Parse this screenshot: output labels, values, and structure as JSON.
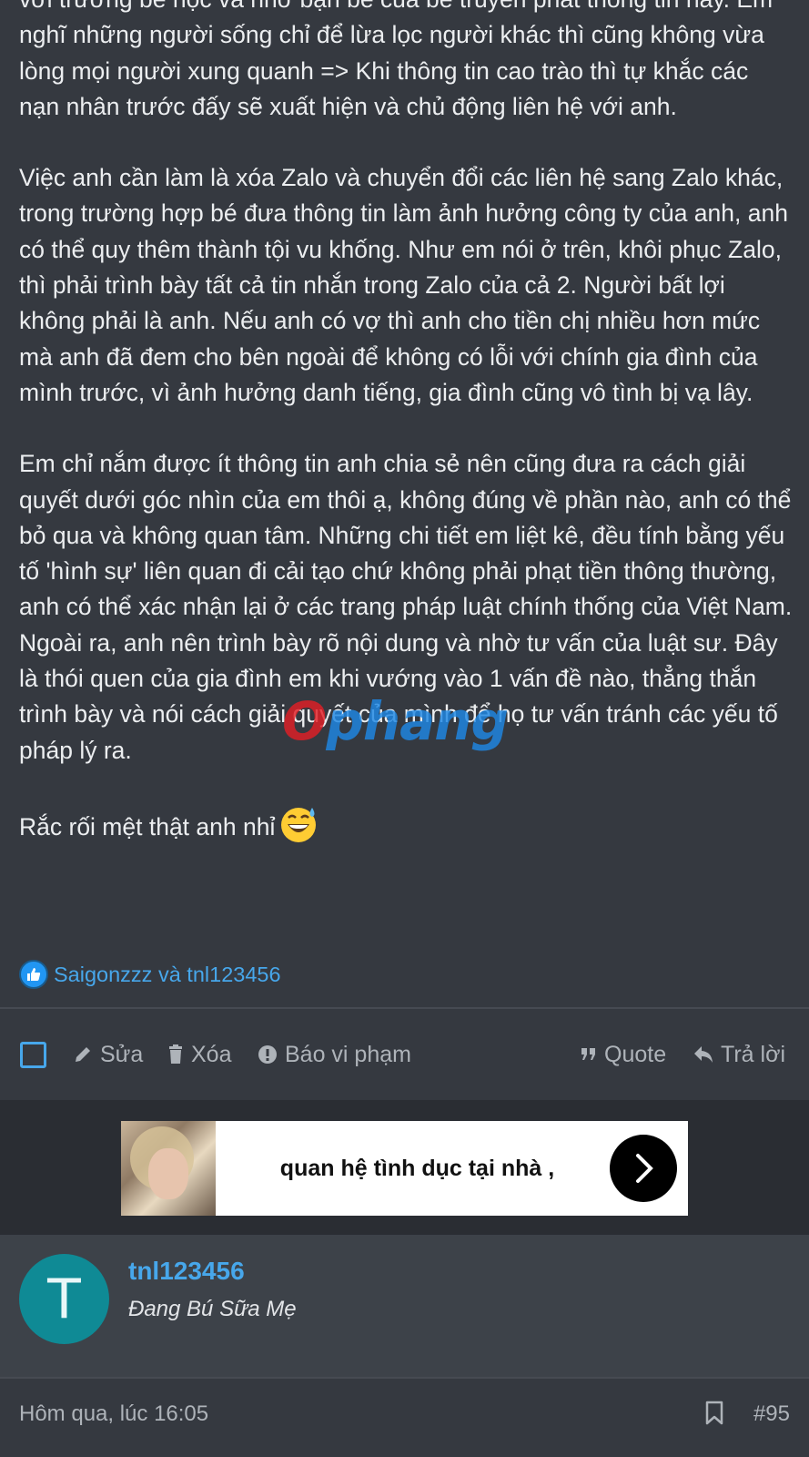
{
  "post": {
    "paragraphs": [
      "với trường bé học và nhờ bạn bè của bé truyền phát thông tin này. Em nghĩ những người sống chỉ để lừa lọc người khác thì cũng không vừa lòng mọi người xung quanh => Khi thông tin cao trào thì tự khắc các nạn nhân trước đấy sẽ xuất hiện và chủ động liên hệ với anh.",
      "Việc anh cần làm là xóa Zalo và chuyển đổi các liên hệ sang Zalo khác, trong trường hợp bé đưa thông tin làm ảnh hưởng công ty của anh, anh có thể quy thêm thành tội vu khống. Như em nói ở trên, khôi phục Zalo, thì phải trình bày tất cả tin nhắn trong Zalo của cả 2. Người bất lợi không phải là anh. Nếu anh có vợ thì anh cho tiền chị nhiều hơn mức mà anh đã đem cho bên ngoài để không có lỗi với chính gia đình của mình trước, vì ảnh hưởng danh tiếng, gia đình cũng vô tình bị vạ lây.",
      "Em chỉ nắm được ít thông tin anh chia sẻ nên cũng đưa ra cách giải quyết dưới góc nhìn của em thôi ạ, không đúng về phần nào, anh có thể bỏ qua và không quan tâm. Những chi tiết em liệt kê, đều tính bằng yếu tố 'hình sự' liên quan đi cải tạo chứ không phải phạt tiền thông thường, anh có thể xác nhận lại ở các trang pháp luật chính thống của Việt Nam. Ngoài ra, anh nên trình bày rõ nội dung và nhờ tư vấn của luật sư. Đây là thói quen của gia đình em khi vướng vào 1 vấn đề nào, thẳng thắn trình bày và nói cách giải quyết của mình để họ tư vấn tránh các yếu tố pháp lý ra.",
      "Rắc rối mệt thật anh nhỉ"
    ],
    "emoji": "grinning-sweat-emoji",
    "reactions_text": "Saigonzzz và tnl123456"
  },
  "watermark": {
    "part1": "O",
    "part2": "phang"
  },
  "actions": {
    "edit": "Sửa",
    "delete": "Xóa",
    "report": "Báo vi phạm",
    "quote": "Quote",
    "reply": "Trả lời"
  },
  "ad": {
    "text": "quan hệ tình dục tại nhà ,"
  },
  "author": {
    "initial": "T",
    "username": "tnl123456",
    "title": "Đang Bú Sữa Mẹ"
  },
  "meta": {
    "date": "Hôm qua, lúc 16:05",
    "number": "#95"
  },
  "colors": {
    "link": "#47a7eb",
    "post_bg": "#353940",
    "author_bg": "#3d4249",
    "avatar": "#0f8a95"
  }
}
